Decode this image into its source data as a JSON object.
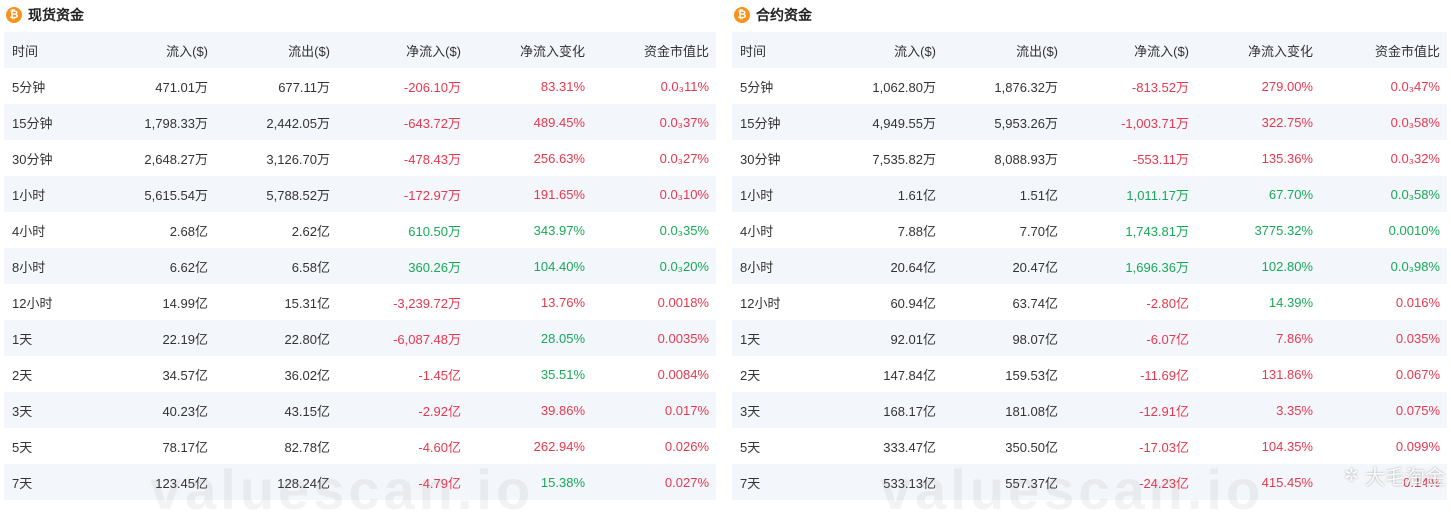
{
  "panels": {
    "spot": {
      "title": "现货资金",
      "headers": [
        "时间",
        "流入($)",
        "流出($)",
        "净流入($)",
        "净流入变化",
        "资金市值比"
      ],
      "rows": [
        {
          "time": "5分钟",
          "inflow": "471.01万",
          "outflow": "677.11万",
          "net": "-206.10万",
          "change": "83.31%",
          "ratio": "0.0₃11%",
          "sign": "neg"
        },
        {
          "time": "15分钟",
          "inflow": "1,798.33万",
          "outflow": "2,442.05万",
          "net": "-643.72万",
          "change": "489.45%",
          "ratio": "0.0₃37%",
          "sign": "neg"
        },
        {
          "time": "30分钟",
          "inflow": "2,648.27万",
          "outflow": "3,126.70万",
          "net": "-478.43万",
          "change": "256.63%",
          "ratio": "0.0₃27%",
          "sign": "neg"
        },
        {
          "time": "1小时",
          "inflow": "5,615.54万",
          "outflow": "5,788.52万",
          "net": "-172.97万",
          "change": "191.65%",
          "ratio": "0.0₃10%",
          "sign": "neg"
        },
        {
          "time": "4小时",
          "inflow": "2.68亿",
          "outflow": "2.62亿",
          "net": "610.50万",
          "change": "343.97%",
          "ratio": "0.0₃35%",
          "sign": "pos"
        },
        {
          "time": "8小时",
          "inflow": "6.62亿",
          "outflow": "6.58亿",
          "net": "360.26万",
          "change": "104.40%",
          "ratio": "0.0₃20%",
          "sign": "pos"
        },
        {
          "time": "12小时",
          "inflow": "14.99亿",
          "outflow": "15.31亿",
          "net": "-3,239.72万",
          "change": "13.76%",
          "ratio": "0.0018%",
          "sign": "neg"
        },
        {
          "time": "1天",
          "inflow": "22.19亿",
          "outflow": "22.80亿",
          "net": "-6,087.48万",
          "change": "28.05%",
          "ratio": "0.0035%",
          "sign": "neg",
          "change_sign": "pos"
        },
        {
          "time": "2天",
          "inflow": "34.57亿",
          "outflow": "36.02亿",
          "net": "-1.45亿",
          "change": "35.51%",
          "ratio": "0.0084%",
          "sign": "neg",
          "change_sign": "pos"
        },
        {
          "time": "3天",
          "inflow": "40.23亿",
          "outflow": "43.15亿",
          "net": "-2.92亿",
          "change": "39.86%",
          "ratio": "0.017%",
          "sign": "neg"
        },
        {
          "time": "5天",
          "inflow": "78.17亿",
          "outflow": "82.78亿",
          "net": "-4.60亿",
          "change": "262.94%",
          "ratio": "0.026%",
          "sign": "neg"
        },
        {
          "time": "7天",
          "inflow": "123.45亿",
          "outflow": "128.24亿",
          "net": "-4.79亿",
          "change": "15.38%",
          "ratio": "0.027%",
          "sign": "neg",
          "change_sign": "pos"
        }
      ]
    },
    "futures": {
      "title": "合约资金",
      "headers": [
        "时间",
        "流入($)",
        "流出($)",
        "净流入($)",
        "净流入变化",
        "资金市值比"
      ],
      "rows": [
        {
          "time": "5分钟",
          "inflow": "1,062.80万",
          "outflow": "1,876.32万",
          "net": "-813.52万",
          "change": "279.00%",
          "ratio": "0.0₃47%",
          "sign": "neg"
        },
        {
          "time": "15分钟",
          "inflow": "4,949.55万",
          "outflow": "5,953.26万",
          "net": "-1,003.71万",
          "change": "322.75%",
          "ratio": "0.0₃58%",
          "sign": "neg"
        },
        {
          "time": "30分钟",
          "inflow": "7,535.82万",
          "outflow": "8,088.93万",
          "net": "-553.11万",
          "change": "135.36%",
          "ratio": "0.0₃32%",
          "sign": "neg"
        },
        {
          "time": "1小时",
          "inflow": "1.61亿",
          "outflow": "1.51亿",
          "net": "1,011.17万",
          "change": "67.70%",
          "ratio": "0.0₃58%",
          "sign": "pos"
        },
        {
          "time": "4小时",
          "inflow": "7.88亿",
          "outflow": "7.70亿",
          "net": "1,743.81万",
          "change": "3775.32%",
          "ratio": "0.0010%",
          "sign": "pos"
        },
        {
          "time": "8小时",
          "inflow": "20.64亿",
          "outflow": "20.47亿",
          "net": "1,696.36万",
          "change": "102.80%",
          "ratio": "0.0₃98%",
          "sign": "pos"
        },
        {
          "time": "12小时",
          "inflow": "60.94亿",
          "outflow": "63.74亿",
          "net": "-2.80亿",
          "change": "14.39%",
          "ratio": "0.016%",
          "sign": "neg",
          "change_sign": "pos"
        },
        {
          "time": "1天",
          "inflow": "92.01亿",
          "outflow": "98.07亿",
          "net": "-6.07亿",
          "change": "7.86%",
          "ratio": "0.035%",
          "sign": "neg"
        },
        {
          "time": "2天",
          "inflow": "147.84亿",
          "outflow": "159.53亿",
          "net": "-11.69亿",
          "change": "131.86%",
          "ratio": "0.067%",
          "sign": "neg"
        },
        {
          "time": "3天",
          "inflow": "168.17亿",
          "outflow": "181.08亿",
          "net": "-12.91亿",
          "change": "3.35%",
          "ratio": "0.075%",
          "sign": "neg"
        },
        {
          "time": "5天",
          "inflow": "333.47亿",
          "outflow": "350.50亿",
          "net": "-17.03亿",
          "change": "104.35%",
          "ratio": "0.099%",
          "sign": "neg"
        },
        {
          "time": "7天",
          "inflow": "533.13亿",
          "outflow": "557.37亿",
          "net": "-24.23亿",
          "change": "415.45%",
          "ratio": "0.14%",
          "sign": "neg"
        }
      ]
    }
  },
  "icons": {
    "panel_icon": "bitcoin-icon",
    "watermark_glyph": "sparkle-icon"
  },
  "watermark": {
    "text": "valuescan.io",
    "corner": "大毛淘金"
  },
  "colors": {
    "negative": "#e8384f",
    "positive": "#18a957",
    "btc": "#f7931a",
    "row_alt": "#f3f6fa"
  }
}
